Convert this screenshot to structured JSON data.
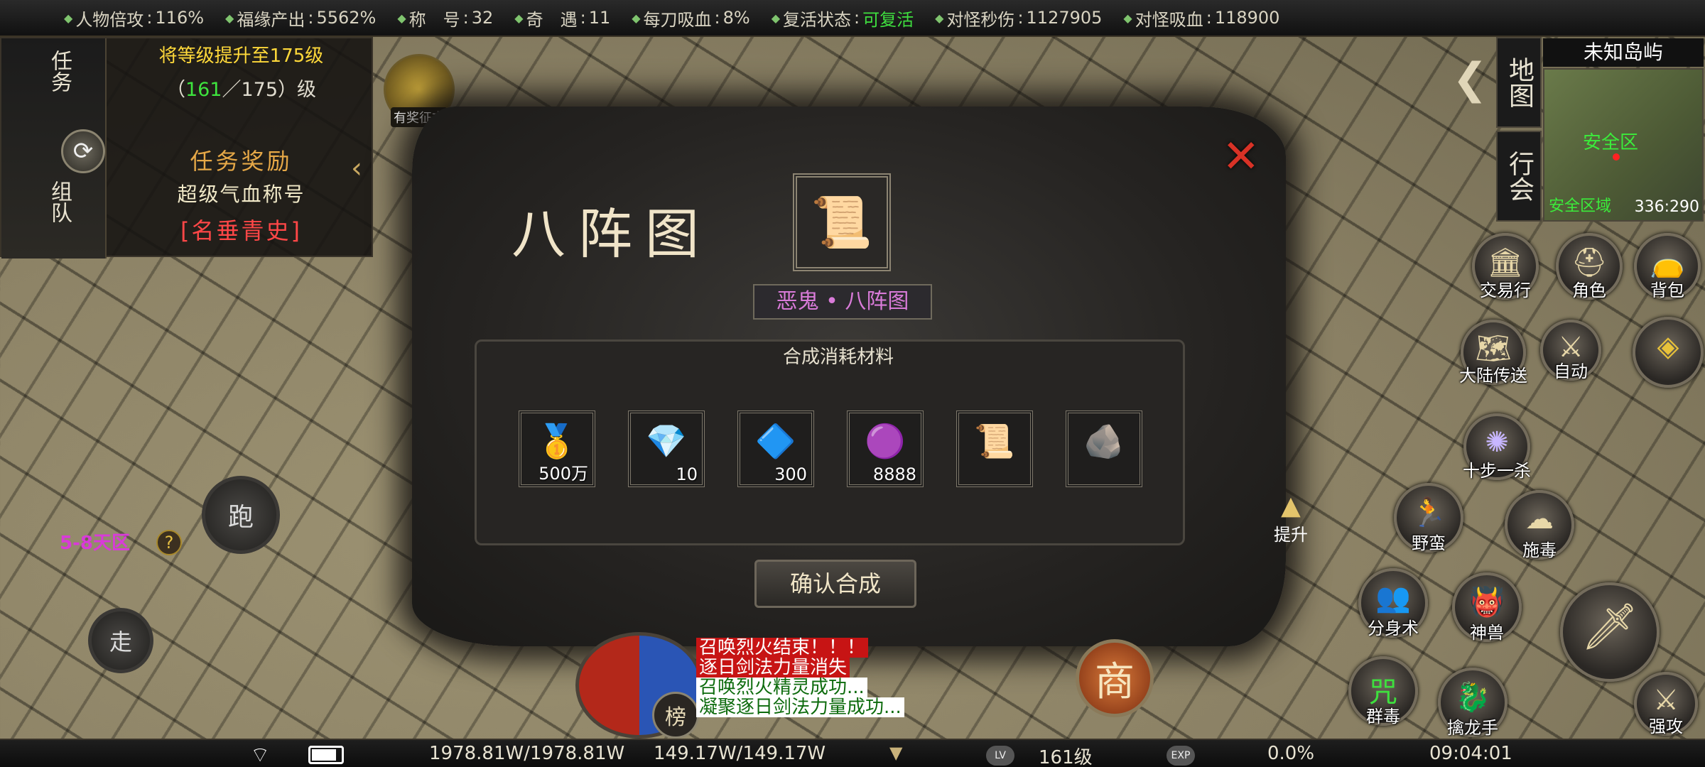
{
  "top_stats": [
    {
      "label": "人物倍攻",
      "value": "116%"
    },
    {
      "label": "福缘产出",
      "value": "5562%"
    },
    {
      "label": "称　号",
      "value": "32"
    },
    {
      "label": "奇　遇",
      "value": "11"
    },
    {
      "label": "每刀吸血",
      "value": "8%"
    },
    {
      "label": "复活状态",
      "value": "可复活",
      "highlight": true
    },
    {
      "label": "对怪秒伤",
      "value": "1127905"
    },
    {
      "label": "对怪吸血",
      "value": "118900"
    }
  ],
  "quest": {
    "tab_task": "任务",
    "tab_team": "组队",
    "title": "将等级提升至175级",
    "progress_open": "（",
    "progress_current": "161",
    "progress_rest": "／175）级",
    "reward_label": "任务奖励",
    "reward_item": "超级气血称号",
    "reward_name": "[名垂青史]"
  },
  "event_label": "有奖征文",
  "dialog": {
    "title": "八阵图",
    "item_name": "恶鬼 • 八阵图",
    "materials_label": "合成消耗材料",
    "materials": [
      {
        "icon": "gold-ingot-icon",
        "glyph": "🥇",
        "count": "500万"
      },
      {
        "icon": "rainbow-crystal-icon",
        "glyph": "💎",
        "count": "10"
      },
      {
        "icon": "blue-crystal-icon",
        "glyph": "🔷",
        "count": "300"
      },
      {
        "icon": "purple-gem-icon",
        "glyph": "🟣",
        "count": "8888"
      },
      {
        "icon": "scroll-icon",
        "glyph": "📜",
        "count": ""
      },
      {
        "icon": "stone-icon",
        "glyph": "🪨",
        "count": ""
      }
    ],
    "confirm_label": "确认合成"
  },
  "map": {
    "tab_map": "地图",
    "tab_guild": "行会",
    "name": "未知岛屿",
    "safe_label": "安全区",
    "zone_label": "安全区域",
    "coords": "336:290"
  },
  "right_buttons": {
    "trade": "交易行",
    "role": "角色",
    "bag": "背包",
    "teleport": "大陆传送",
    "auto": "自动",
    "skill_1": "十步一杀",
    "upgrade": "提升",
    "skill_wild": "野蛮",
    "skill_poison": "施毒",
    "skill_clone": "分身术",
    "skill_beast": "神兽",
    "skill_group_poison": "群毒",
    "skill_dragon": "擒龙手",
    "attack": "强攻"
  },
  "left": {
    "run": "跑",
    "walk": "走",
    "zone": "5-8天区",
    "help": "?"
  },
  "chat": [
    {
      "text": "召唤烈火结束！！！",
      "bg": "#c71414",
      "color": "#ffffff"
    },
    {
      "text": "逐日剑法力量消失",
      "bg": "#c71414",
      "color": "#ffffff"
    },
    {
      "text": "召唤烈火精灵成功...",
      "bg": "#ffffff",
      "color": "#0d6b0d"
    },
    {
      "text": "凝聚逐日剑法力量成功...",
      "bg": "#ffffff",
      "color": "#0d6b0d"
    }
  ],
  "rank_label": "榜",
  "shop_label": "商",
  "bottom": {
    "hp": "1978.81W/1978.81W",
    "mp": "149.17W/149.17W",
    "lv_badge": "LV",
    "level": "161级",
    "exp_badge": "EXP",
    "exp": "0.0%",
    "time": "09:04:01",
    "battery_level": 0.85
  }
}
